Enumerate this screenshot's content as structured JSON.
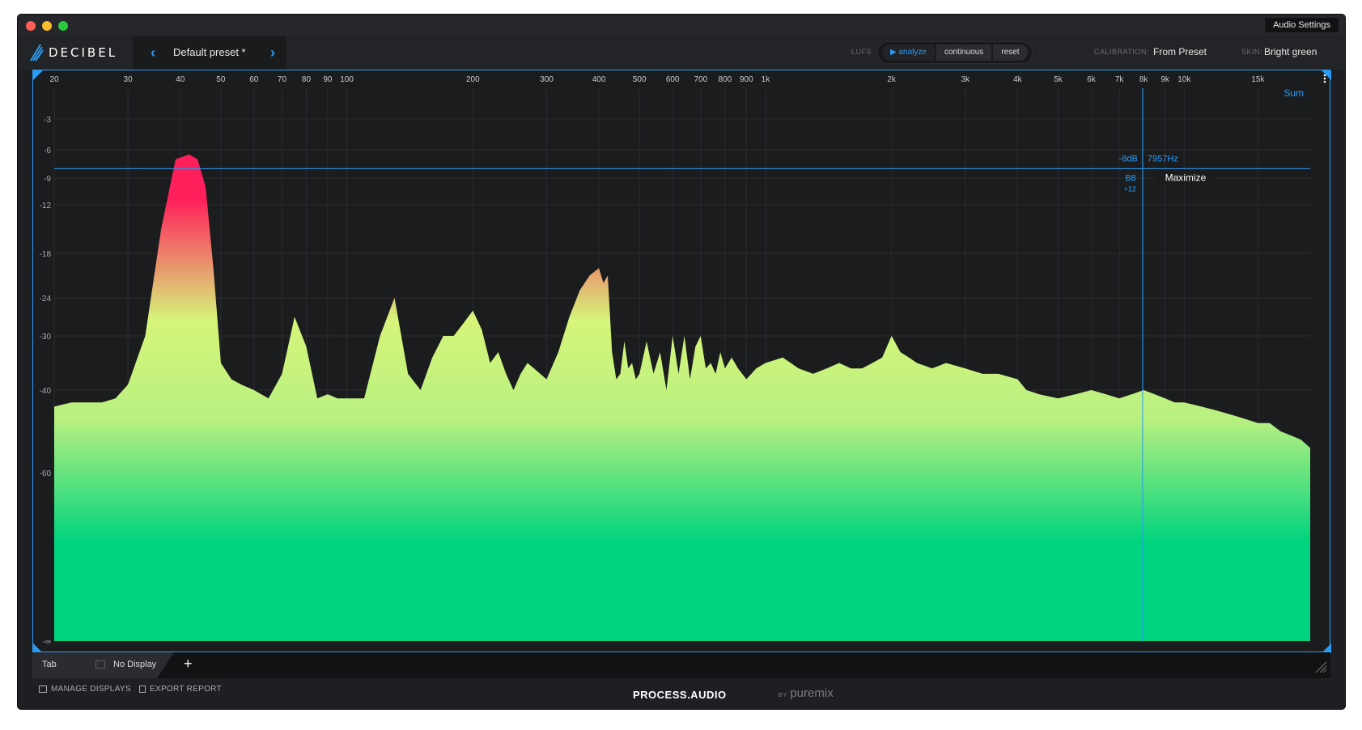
{
  "titlebar": {
    "audio_settings": "Audio Settings"
  },
  "toolbar": {
    "logo": "DECIBEL",
    "preset_name": "Default preset *",
    "prev_arrow": "‹",
    "next_arrow": "›",
    "lufs_label": "LUFS",
    "lufs_buttons": [
      "▶ analyze",
      "continuous",
      "reset"
    ],
    "calibration_label": "CALIBRATION:",
    "calibration_value": "From Preset",
    "skin_label": "SKIN:",
    "skin_value": "Bright green"
  },
  "display": {
    "sum_label": "Sum",
    "freq_ticks": [
      "20",
      "30",
      "40",
      "50",
      "60",
      "70",
      "80",
      "90",
      "100",
      "200",
      "300",
      "400",
      "500",
      "600",
      "700",
      "800",
      "900",
      "1k",
      "2k",
      "3k",
      "4k",
      "5k",
      "6k",
      "7k",
      "8k",
      "9k",
      "10k",
      "15k"
    ],
    "db_ticks": [
      "-3",
      "-6",
      "-9",
      "-12",
      "-18",
      "-24",
      "-30",
      "-40",
      "-60",
      "-∞"
    ],
    "cursor": {
      "db": "-8dB",
      "hz": "7957Hz",
      "note": "B8",
      "cents": "+12",
      "tooltip": "Maximize"
    }
  },
  "chart_data": {
    "type": "area",
    "xlabel": "",
    "ylabel": "",
    "x_scale": "log",
    "xlim": [
      20,
      20000
    ],
    "y_ticks_db": [
      "-3",
      "-6",
      "-9",
      "-12",
      "-18",
      "-24",
      "-30",
      "-40",
      "-60",
      "-∞"
    ],
    "series": [
      {
        "x": [
          20,
          22,
          24,
          26,
          28,
          30,
          33,
          36,
          39,
          42,
          44,
          46,
          48,
          50,
          53,
          56,
          60,
          65,
          70,
          75,
          80,
          85,
          90,
          95,
          100,
          110,
          120,
          130,
          140,
          150,
          160,
          170,
          180,
          190,
          200,
          210,
          220,
          230,
          240,
          250,
          260,
          270,
          280,
          300,
          320,
          340,
          360,
          380,
          400,
          410,
          420,
          430,
          440,
          450,
          460,
          470,
          480,
          490,
          500,
          520,
          540,
          560,
          580,
          600,
          620,
          640,
          660,
          680,
          700,
          720,
          740,
          760,
          780,
          800,
          830,
          860,
          900,
          950,
          1000,
          1100,
          1200,
          1300,
          1400,
          1500,
          1600,
          1700,
          1800,
          1900,
          2000,
          2100,
          2200,
          2300,
          2500,
          2700,
          3000,
          3300,
          3600,
          4000,
          4200,
          4500,
          5000,
          5500,
          6000,
          6500,
          7000,
          7500,
          8000,
          8500,
          9000,
          9500,
          10000,
          11000,
          12000,
          13000,
          14000,
          15000,
          16000,
          17000,
          18000,
          19000,
          20000
        ],
        "y": [
          -44,
          -43,
          -43,
          -43,
          -42,
          -39,
          -30,
          -15,
          -7,
          -6.5,
          -7,
          -10,
          -20,
          -35,
          -38,
          -39,
          -40,
          -42,
          -37,
          -27,
          -32,
          -42,
          -41,
          -42,
          -42,
          -42,
          -30,
          -24,
          -37,
          -40,
          -34,
          -30,
          -30,
          -28,
          -26,
          -29,
          -35,
          -33,
          -37,
          -40,
          -37,
          -35,
          -36,
          -38,
          -33,
          -27,
          -23,
          -21,
          -20,
          -22,
          -21,
          -33,
          -38,
          -37,
          -31,
          -36,
          -35,
          -38,
          -37,
          -31,
          -37,
          -33,
          -40,
          -30,
          -37,
          -30,
          -38,
          -32,
          -30,
          -36,
          -35,
          -37,
          -33,
          -36,
          -34,
          -36,
          -38,
          -36,
          -35,
          -34,
          -36,
          -37,
          -36,
          -35,
          -36,
          -36,
          -35,
          -34,
          -30,
          -33,
          -34,
          -35,
          -36,
          -35,
          -36,
          -37,
          -37,
          -38,
          -40,
          -41,
          -42,
          -41,
          -40,
          -41,
          -42,
          -41,
          -40,
          -41,
          -42,
          -43,
          -43,
          -44,
          -45,
          -46,
          -47,
          -48,
          -48,
          -50,
          -51,
          -52,
          -54
        ]
      }
    ]
  },
  "tabs": {
    "active": "Tab",
    "no_display": "No Display",
    "add": "+"
  },
  "footer": {
    "manage_displays": "MANAGE DISPLAYS",
    "export_report": "EXPORT REPORT",
    "brand": "PROCESS.AUDIO",
    "by": "BY",
    "partner": "puremix"
  },
  "colors": {
    "accent": "#2a9bf5",
    "peak": "#ff1f5a",
    "mid": "#d6f57a",
    "low": "#00d47e"
  }
}
